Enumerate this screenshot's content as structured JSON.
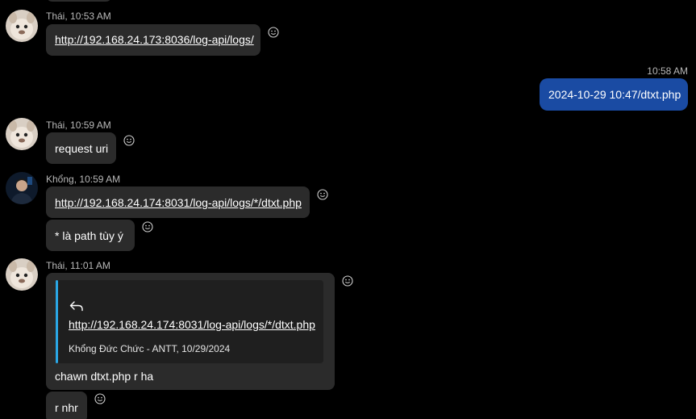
{
  "colors": {
    "background": "#000000",
    "bubble_in": "#2b2b2b",
    "bubble_out": "#1a4ba3",
    "quote_bar": "#2aa7e6",
    "meta_text": "#b8b8b8"
  },
  "messages": [
    {
      "sender": "Thái,",
      "time": "10:53 AM",
      "text": "http://192.168.24.173:8036/log-api/logs/",
      "reaction_icon": "smiley-icon"
    },
    {
      "time": "10:58 AM",
      "text": "2024-10-29 10:47/dtxt.php"
    },
    {
      "sender": "Thái,",
      "time": "10:59 AM",
      "text": "request uri",
      "reaction_icon": "smiley-icon"
    },
    {
      "sender": "Khổng,",
      "time": "10:59 AM",
      "text": "http://192.168.24.174:8031/log-api/logs/*/dtxt.php",
      "followup": "* là path tùy ý",
      "reaction_icon": "smiley-icon"
    },
    {
      "sender": "Thái,",
      "time": "11:01 AM",
      "quote": {
        "icon": "reply-arrow-icon",
        "text": "http://192.168.24.174:8031/log-api/logs/*/dtxt.php",
        "attribution": "Khổng Đức Chức - ANTT, 10/29/2024"
      },
      "text": "chawn dtxt.php r ha",
      "followup": "r nhr",
      "reaction_icon": "smiley-icon"
    }
  ]
}
